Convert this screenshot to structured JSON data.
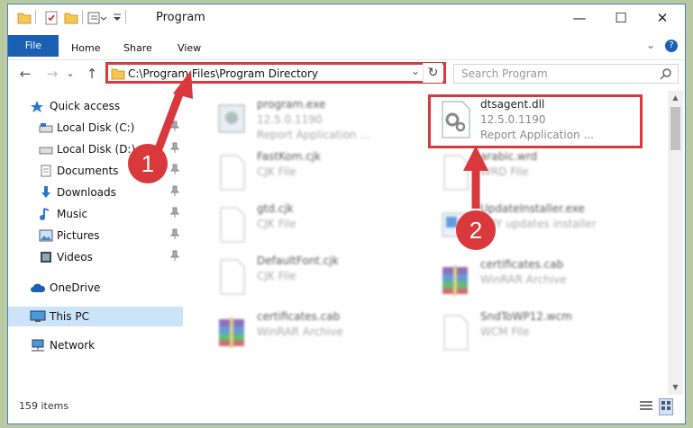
{
  "window": {
    "title": "Program",
    "minimize": "—",
    "maximize": "☐",
    "close": "✕"
  },
  "ribbon": {
    "tabs": [
      "File",
      "Home",
      "Share",
      "View"
    ],
    "chevron": "⌄",
    "help": "?"
  },
  "nav": {
    "back": "←",
    "forward": "→",
    "recent": "⌄",
    "up": "↑",
    "address": "C:\\Program Files\\Program Directory",
    "refresh": "↻",
    "dropdown": "⌄",
    "search_placeholder": "Search Program"
  },
  "sidebar": {
    "items": [
      {
        "label": "Quick access",
        "icon": "star-icon",
        "pinned": false,
        "selected": false
      },
      {
        "label": "Local Disk (C:)",
        "icon": "drive-icon",
        "pinned": true,
        "selected": false
      },
      {
        "label": "Local Disk (D:)",
        "icon": "drive-icon",
        "pinned": true,
        "selected": false
      },
      {
        "label": "Documents",
        "icon": "documents-icon",
        "pinned": true,
        "selected": false
      },
      {
        "label": "Downloads",
        "icon": "download-icon",
        "pinned": true,
        "selected": false
      },
      {
        "label": "Music",
        "icon": "music-icon",
        "pinned": true,
        "selected": false
      },
      {
        "label": "Pictures",
        "icon": "pictures-icon",
        "pinned": true,
        "selected": false
      },
      {
        "label": "Videos",
        "icon": "videos-icon",
        "pinned": true,
        "selected": false
      },
      {
        "label": "OneDrive",
        "icon": "cloud-icon",
        "pinned": false,
        "selected": false
      },
      {
        "label": "This PC",
        "icon": "computer-icon",
        "pinned": false,
        "selected": true
      },
      {
        "label": "Network",
        "icon": "network-icon",
        "pinned": false,
        "selected": false
      }
    ],
    "pin_glyph": "📌"
  },
  "files": {
    "left": [
      {
        "name": "program.exe",
        "line1": "12.5.0.1190",
        "line2": "Report Application ..."
      },
      {
        "name": "FastKom.cjk",
        "line1": "CJK File",
        "line2": ""
      },
      {
        "name": "gtd.cjk",
        "line1": "CJK File",
        "line2": ""
      },
      {
        "name": "DefaultFont.cjk",
        "line1": "CJK File",
        "line2": ""
      },
      {
        "name": "certificates.cab",
        "line1": "WinRAR Archive",
        "line2": ""
      }
    ],
    "right": [
      {
        "name": "dtsagent.dll",
        "line1": "12.5.0.1190",
        "line2": "Report Application ..."
      },
      {
        "name": "arabic.wrd",
        "line1": "WRD File",
        "line2": ""
      },
      {
        "name": "UpdateInstaller.exe",
        "line1": "OBY updates installer",
        "line2": ""
      },
      {
        "name": "certificates.cab",
        "line1": "WinRAR Archive",
        "line2": ""
      },
      {
        "name": "SndToWP12.wcm",
        "line1": "WCM File",
        "line2": ""
      }
    ]
  },
  "status": {
    "item_count": "159 items"
  },
  "annotations": {
    "step1": "1",
    "step2": "2"
  },
  "colors": {
    "accent": "#1a5fb4",
    "highlight_red": "#d9383c",
    "selection": "#cce4f7"
  }
}
